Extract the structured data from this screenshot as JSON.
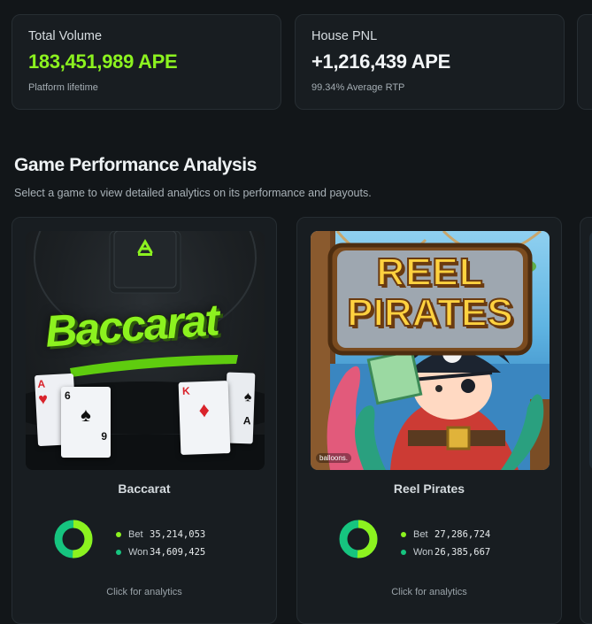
{
  "stats": [
    {
      "label": "Total Volume",
      "value": "183,451,989 APE",
      "sub": "Platform lifetime"
    },
    {
      "label": "House PNL",
      "value": "+1,216,439 APE",
      "sub": "99.34% Average RTP"
    }
  ],
  "section": {
    "title": "Game Performance Analysis",
    "subtitle": "Select a game to view detailed analytics on its performance and payouts."
  },
  "games": [
    {
      "name": "Baccarat",
      "logo_text": "Baccarat",
      "bet_label": "Bet",
      "bet_value": "35,214,053",
      "won_label": "Won",
      "won_value": "34,609,425",
      "cta": "Click for analytics",
      "cards": [
        {
          "rank": "A",
          "suit": "♥"
        },
        {
          "rank": "6",
          "suit": "♠",
          "bottom": "9"
        },
        {
          "rank": "K",
          "suit": "♦"
        },
        {
          "rank": "A",
          "suit": "♠"
        }
      ]
    },
    {
      "name": "Reel Pirates",
      "logo_line1": "REEL",
      "logo_line2": "PIRATES",
      "watermark": "balloons.",
      "bet_label": "Bet",
      "bet_value": "27,286,724",
      "won_label": "Won",
      "won_value": "26,385,667",
      "cta": "Click for analytics"
    }
  ],
  "colors": {
    "accent": "#8cf21f",
    "won": "#16c47f",
    "bg": "#121619",
    "card": "#181d21"
  }
}
